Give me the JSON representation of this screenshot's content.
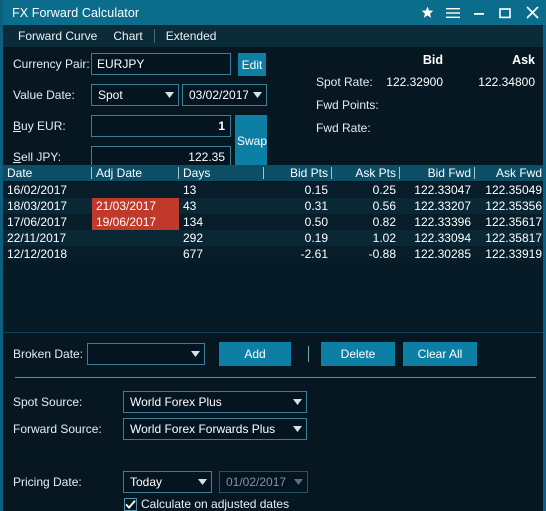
{
  "window": {
    "title": "FX Forward Calculator",
    "controls": [
      {
        "name": "favorite-icon",
        "glyph": "star"
      },
      {
        "name": "menu-icon",
        "glyph": "hamburger"
      },
      {
        "name": "minimize-button",
        "glyph": "minimize"
      },
      {
        "name": "maximize-button",
        "glyph": "maximize"
      },
      {
        "name": "close-button",
        "glyph": "close"
      }
    ],
    "accent_color": "#0b6c8c"
  },
  "menubar": {
    "items": [
      "Forward Curve",
      "Chart",
      "Extended"
    ]
  },
  "form": {
    "currency_pair_label": "Currency Pair:",
    "currency_pair_value": "EURJPY",
    "edit_button": "Edit",
    "value_date_label": "Value Date:",
    "value_date_tenor": "Spot",
    "value_date_date": "03/02/2017",
    "buy_label_prefix": "B",
    "buy_label_rest": "uy EUR:",
    "buy_value": "1",
    "sell_label_prefix": "S",
    "sell_label_rest": "ell JPY:",
    "sell_value": "122.35",
    "swap_button": "Swap"
  },
  "rates": {
    "bid_header": "Bid",
    "ask_header": "Ask",
    "spot_rate_label": "Spot Rate:",
    "spot_rate_bid": "122.32900",
    "spot_rate_ask": "122.34800",
    "fwd_points_label": "Fwd Points:",
    "fwd_points_bid": "",
    "fwd_points_ask": "",
    "fwd_rate_label": "Fwd Rate:",
    "fwd_rate_bid": "",
    "fwd_rate_ask": ""
  },
  "grid": {
    "columns": [
      "Date",
      "Adj Date",
      "Days",
      "Bid Pts",
      "Ask Pts",
      "Bid Fwd",
      "Ask Fwd"
    ],
    "highlight_color": "#c0392b",
    "rows": [
      {
        "date": "16/02/2017",
        "adj_date": "",
        "adj_highlight": false,
        "days": "13",
        "bid_pts": "0.15",
        "ask_pts": "0.25",
        "bid_fwd": "122.33047",
        "ask_fwd": "122.35049"
      },
      {
        "date": "18/03/2017",
        "adj_date": "21/03/2017",
        "adj_highlight": true,
        "days": "43",
        "bid_pts": "0.31",
        "ask_pts": "0.56",
        "bid_fwd": "122.33207",
        "ask_fwd": "122.35356"
      },
      {
        "date": "17/06/2017",
        "adj_date": "19/06/2017",
        "adj_highlight": true,
        "days": "134",
        "bid_pts": "0.50",
        "ask_pts": "0.82",
        "bid_fwd": "122.33396",
        "ask_fwd": "122.35617"
      },
      {
        "date": "22/11/2017",
        "adj_date": "",
        "adj_highlight": false,
        "days": "292",
        "bid_pts": "0.19",
        "ask_pts": "1.02",
        "bid_fwd": "122.33094",
        "ask_fwd": "122.35817"
      },
      {
        "date": "12/12/2018",
        "adj_date": "",
        "adj_highlight": false,
        "days": "677",
        "bid_pts": "-2.61",
        "ask_pts": "-0.88",
        "bid_fwd": "122.30285",
        "ask_fwd": "122.33919"
      }
    ]
  },
  "broken_date": {
    "label": "Broken Date:",
    "value": "",
    "add_button": "Add",
    "delete_button": "Delete",
    "clear_all_button": "Clear All"
  },
  "sources": {
    "spot_source_label": "Spot Source:",
    "spot_source_value": "World Forex Plus",
    "forward_source_label": "Forward Source:",
    "forward_source_value": "World Forex Forwards Plus"
  },
  "pricing": {
    "label": "Pricing Date:",
    "mode": "Today",
    "date": "01/02/2017",
    "checkbox_label": "Calculate on adjusted dates",
    "checkbox_checked": true
  }
}
